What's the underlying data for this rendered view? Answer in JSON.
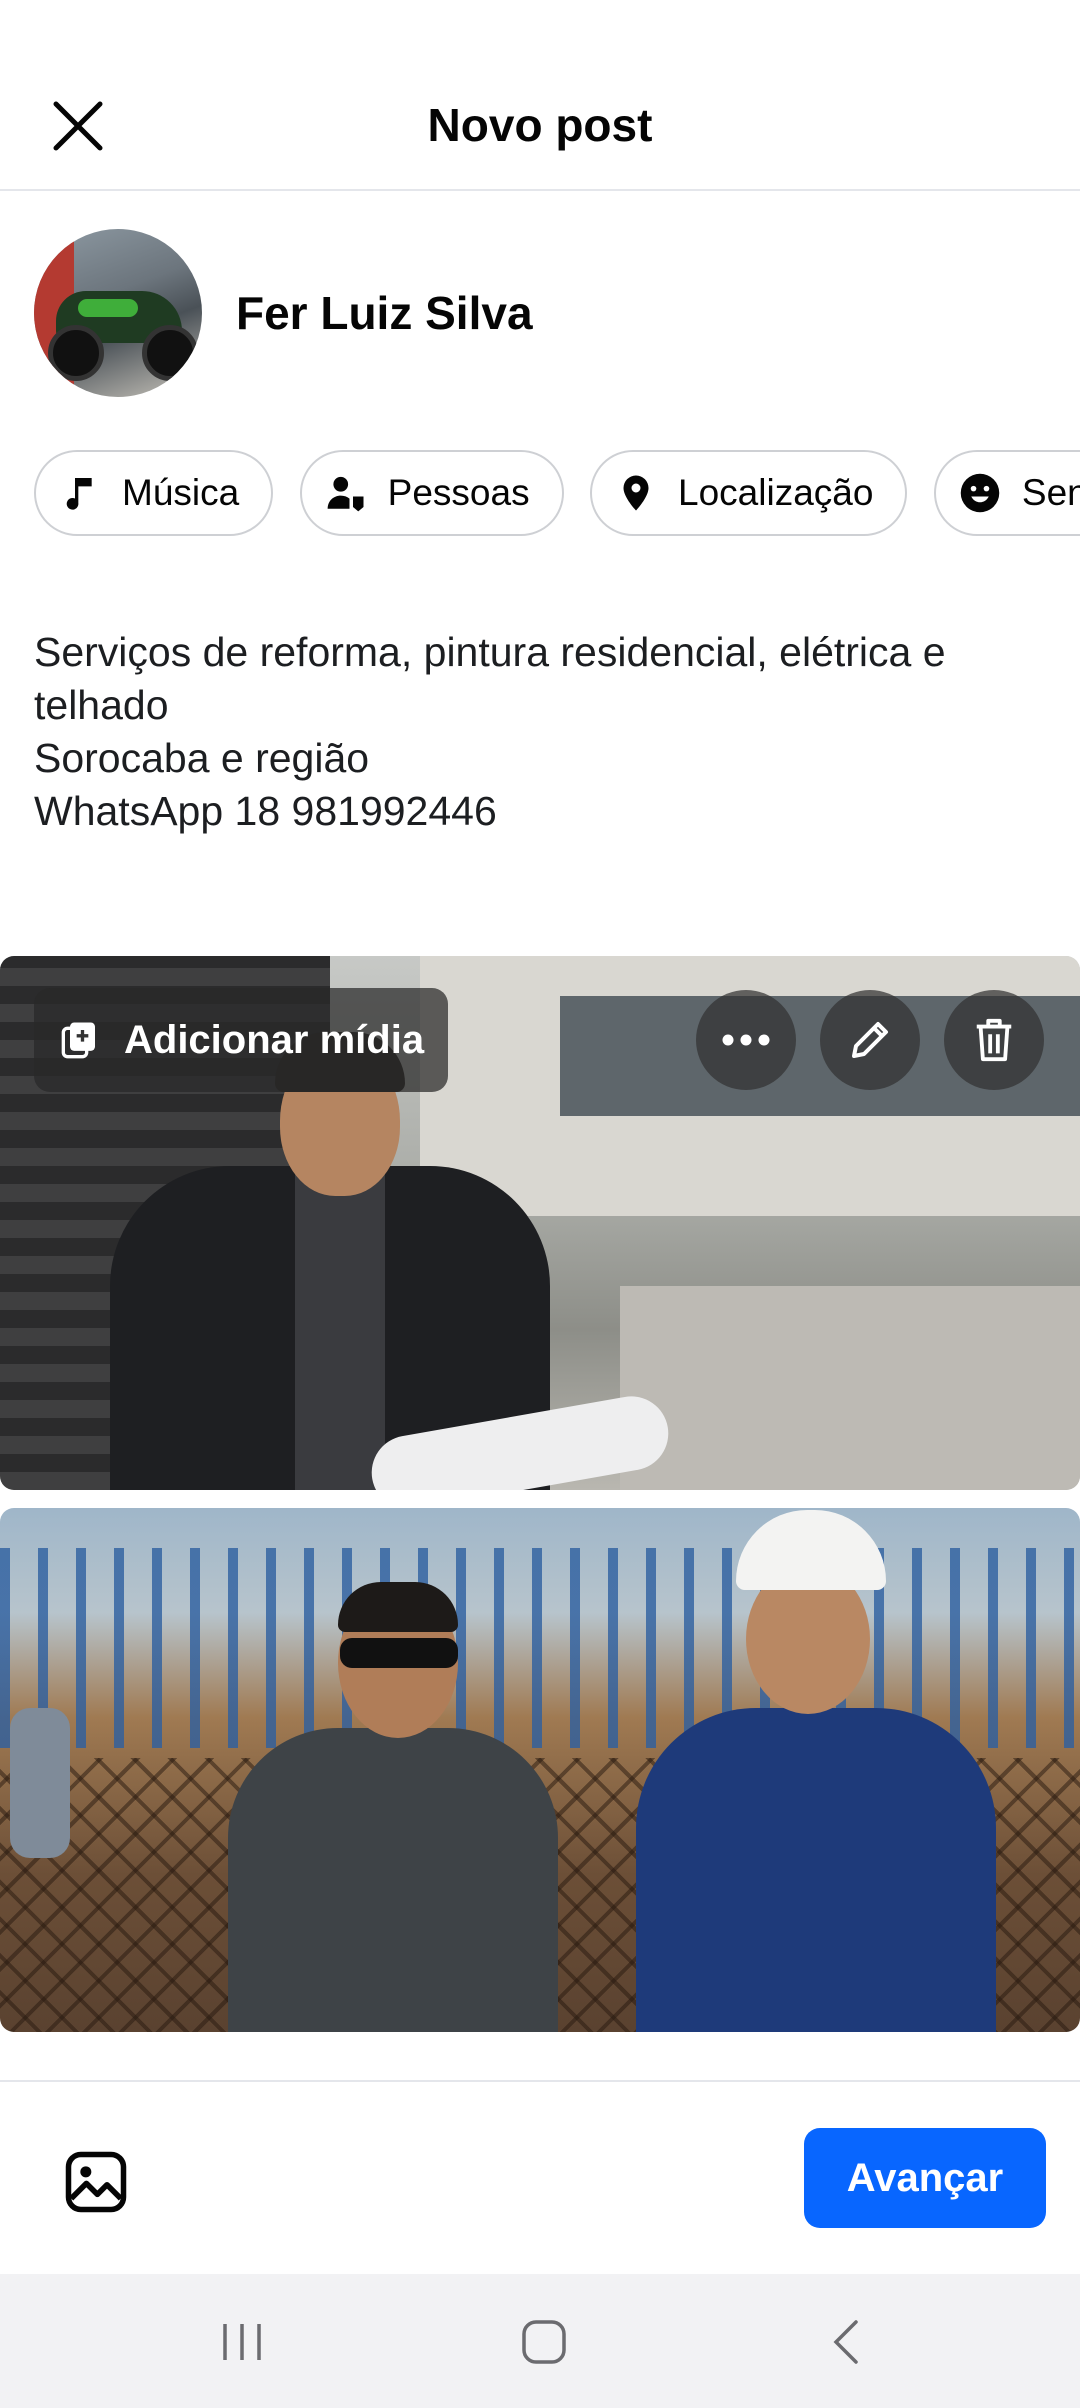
{
  "header": {
    "title": "Novo post"
  },
  "author": {
    "name": "Fer Luiz Silva"
  },
  "chips": [
    {
      "label": "Música",
      "icon": "music-note-icon"
    },
    {
      "label": "Pessoas",
      "icon": "tag-people-icon"
    },
    {
      "label": "Localização",
      "icon": "location-pin-icon"
    },
    {
      "label": "Sentimento",
      "icon": "smiley-icon"
    }
  ],
  "post": {
    "text": "Serviços de reforma,  pintura residencial,  elétrica e telhado\nSorocaba e região\nWhatsApp 18 981992446"
  },
  "media": {
    "add_media_label": "Adicionar mídia"
  },
  "footer": {
    "next_label": "Avançar"
  },
  "colors": {
    "accent": "#0866ff",
    "border": "#ced0d4"
  }
}
